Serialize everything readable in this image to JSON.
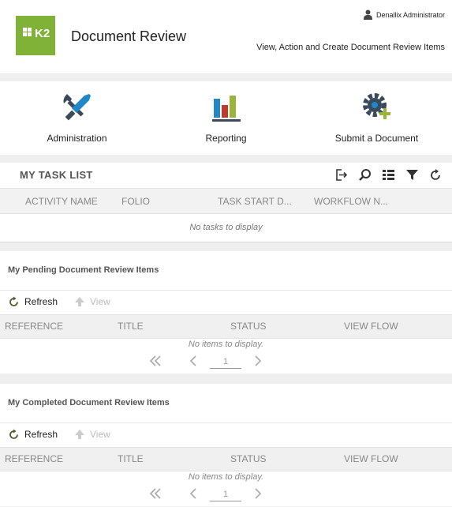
{
  "header": {
    "logo_text": "K2",
    "title": "Document Review",
    "user": "Denallix Administrator",
    "subtitle": "View, Action and Create Document Review Items"
  },
  "nav": {
    "items": [
      {
        "label": "Administration",
        "icon": "tools-icon"
      },
      {
        "label": "Reporting",
        "icon": "bar-chart-icon"
      },
      {
        "label": "Submit a Document",
        "icon": "gear-add-icon"
      }
    ]
  },
  "task_list": {
    "title": "MY TASK LIST",
    "tools": [
      "open-icon",
      "search-icon",
      "list-icon",
      "filter-icon",
      "refresh-icon"
    ],
    "columns": [
      "ACTIVITY NAME",
      "FOLIO",
      "TASK START D...",
      "WORKFLOW N..."
    ],
    "empty": "No tasks to display"
  },
  "pending": {
    "title": "My Pending Document Review Items",
    "refresh_label": "Refresh",
    "view_label": "View",
    "columns": [
      "REFERENCE",
      "TITLE",
      "STATUS",
      "VIEW FLOW"
    ],
    "empty": "No items to display.",
    "page": "1"
  },
  "completed": {
    "title": "My Completed Document Review Items",
    "refresh_label": "Refresh",
    "view_label": "View",
    "columns": [
      "REFERENCE",
      "TITLE",
      "STATUS",
      "VIEW FLOW"
    ],
    "empty": "No items to display.",
    "page": "1"
  },
  "colors": {
    "brand": "#7fb236",
    "icon_dark": "#3a4a5c",
    "refresh": "#4a5a2a"
  }
}
